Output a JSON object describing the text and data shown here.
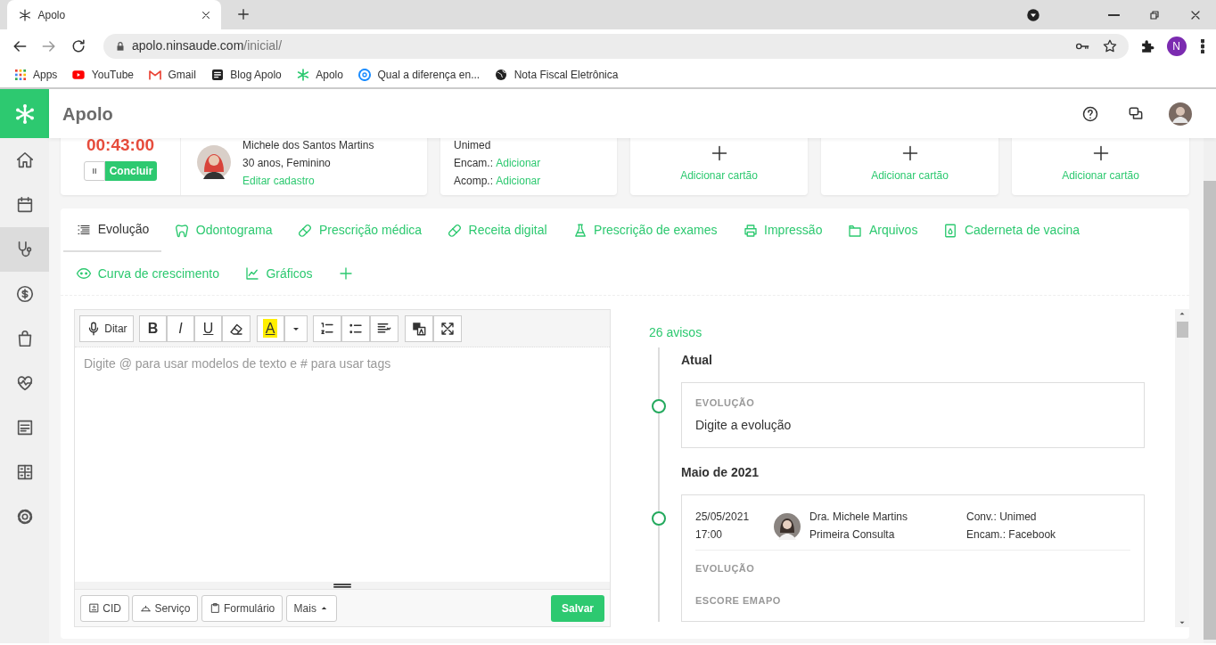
{
  "browser": {
    "tab_title": "Apolo",
    "url_domain": "apolo.ninsaude.com",
    "url_path": "/inicial/",
    "profile_initial": "N",
    "bookmarks": [
      {
        "label": "Apps"
      },
      {
        "label": "YouTube"
      },
      {
        "label": "Gmail"
      },
      {
        "label": "Blog Apolo"
      },
      {
        "label": "Apolo"
      },
      {
        "label": "Qual a diferença en..."
      },
      {
        "label": "Nota Fiscal Eletrônica"
      }
    ]
  },
  "app": {
    "title": "Apolo"
  },
  "sidebar": {
    "items": [
      {
        "selected": false
      },
      {
        "selected": false
      },
      {
        "selected": true
      },
      {
        "selected": false
      },
      {
        "selected": false
      },
      {
        "selected": false
      },
      {
        "selected": false
      },
      {
        "selected": false
      },
      {
        "selected": false
      }
    ]
  },
  "timer": {
    "time": "00:43:00",
    "finish_button": "Concluir"
  },
  "patient": {
    "name": "Michele dos Santos Martins",
    "details": "30 anos, Feminino",
    "edit_link": "Editar cadastro"
  },
  "insurance": {
    "plan": "Unimed",
    "rows": [
      {
        "label": "Encam.:",
        "link": "Adicionar"
      },
      {
        "label": "Acomp.:",
        "link": "Adicionar"
      }
    ]
  },
  "add_cards": [
    {
      "label": "Adicionar cartão"
    },
    {
      "label": "Adicionar cartão"
    },
    {
      "label": "Adicionar cartão"
    }
  ],
  "tabs": [
    {
      "label": "Evolução",
      "selected": true
    },
    {
      "label": "Odontograma",
      "selected": false
    },
    {
      "label": "Prescrição médica",
      "selected": false
    },
    {
      "label": "Receita digital",
      "selected": false
    },
    {
      "label": "Prescrição de exames",
      "selected": false
    },
    {
      "label": "Impressão",
      "selected": false
    },
    {
      "label": "Arquivos",
      "selected": false
    },
    {
      "label": "Caderneta de vacina",
      "selected": false
    },
    {
      "label": "Curva de crescimento",
      "selected": false
    },
    {
      "label": "Gráficos",
      "selected": false
    }
  ],
  "editor": {
    "dictate_button": "Ditar",
    "format_buttons": [
      "B",
      "I",
      "U"
    ],
    "highlight_letter": "A",
    "placeholder": "Digite @ para usar modelos de texto e # para usar tags",
    "footer_buttons": [
      "CID",
      "Serviço",
      "Formulário",
      "Mais"
    ],
    "save_button": "Salvar"
  },
  "timeline": {
    "count": "26 avisos",
    "groups": [
      {
        "heading": "Atual",
        "entries": [
          {
            "kind": "note",
            "section": "EVOLUÇÃO",
            "text": "Digite a evolução"
          }
        ]
      },
      {
        "heading": "Maio de 2021",
        "entries": [
          {
            "kind": "visit",
            "date": "25/05/2021",
            "time": "17:00",
            "doctor": "Dra. Michele Martins",
            "visit_type": "Primeira Consulta",
            "insurance": "Conv.: Unimed",
            "referral": "Encam.: Facebook",
            "sections": [
              "EVOLUÇÃO",
              "ESCORE EMAPO"
            ]
          }
        ]
      }
    ]
  }
}
